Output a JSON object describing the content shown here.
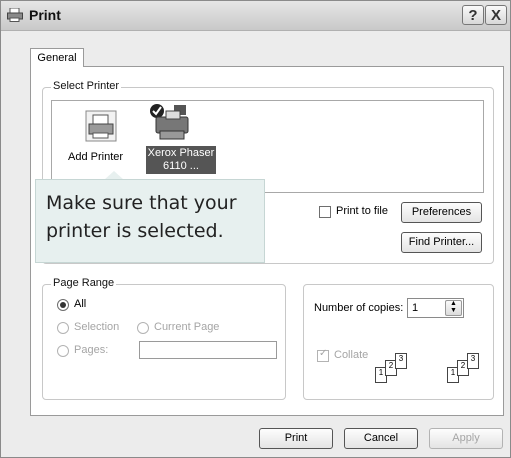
{
  "window": {
    "title": "Print",
    "help_button": "?",
    "close_button": "X"
  },
  "tabs": [
    {
      "label": "General"
    }
  ],
  "select_printer": {
    "legend": "Select Printer",
    "printers": [
      {
        "label": "Add Printer",
        "icon": "add-printer-icon"
      },
      {
        "label_line1": "Xerox Phaser",
        "label_line2": "6110 ...",
        "icon": "xerox-phaser-printer-icon",
        "selected": true
      }
    ],
    "print_to_file_label": "Print to file",
    "preferences_button": "Preferences",
    "find_printer_button": "Find Printer..."
  },
  "callout": {
    "text": "Make sure that your printer is selected."
  },
  "page_range": {
    "legend": "Page Range",
    "all_label": "All",
    "selection_label": "Selection",
    "current_page_label": "Current Page",
    "pages_label": "Pages:",
    "pages_value": "",
    "selected": "All"
  },
  "copies": {
    "number_label": "Number of copies:",
    "number_value": "1",
    "collate_label": "Collate",
    "collate_checked": true,
    "collate_pages": [
      "1",
      "2",
      "3"
    ]
  },
  "footer": {
    "print_button": "Print",
    "cancel_button": "Cancel",
    "apply_button": "Apply"
  }
}
